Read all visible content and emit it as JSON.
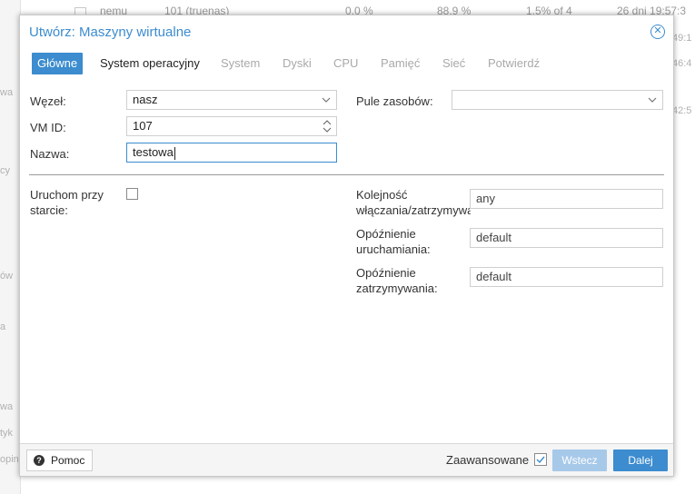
{
  "background": {
    "row_cells": [
      "nemu",
      "101 (truenas)",
      "0.0 %",
      "88.9 %",
      "1.5% of 4",
      "26 dni 19:57:3"
    ],
    "right_fragments": [
      "49:1",
      "46:4",
      "42:5"
    ],
    "left_fragments": [
      "wa",
      "cy",
      "ów",
      "a",
      "wa",
      "tyk",
      "opin"
    ]
  },
  "dialog": {
    "title": "Utwórz: Maszyny wirtualne",
    "close_icon": "close-circle-icon",
    "tabs": [
      {
        "label": "Główne",
        "state": "active"
      },
      {
        "label": "System operacyjny",
        "state": "normal"
      },
      {
        "label": "System",
        "state": "disabled"
      },
      {
        "label": "Dyski",
        "state": "disabled"
      },
      {
        "label": "CPU",
        "state": "disabled"
      },
      {
        "label": "Pamięć",
        "state": "disabled"
      },
      {
        "label": "Sieć",
        "state": "disabled"
      },
      {
        "label": "Potwierdź",
        "state": "disabled"
      }
    ],
    "form": {
      "node_label": "Węzeł:",
      "node_value": "nasz",
      "vmid_label": "VM ID:",
      "vmid_value": "107",
      "name_label": "Nazwa:",
      "name_value": "testowa",
      "pool_label": "Pule zasobów:",
      "pool_value": "",
      "onboot_label_1": "Uruchom przy",
      "onboot_label_2": "starcie:",
      "order_label_1": "Kolejność",
      "order_label_2": "włączania/zatrzymywa",
      "order_value": "any",
      "startup_delay_label_1": "Opóźnienie",
      "startup_delay_label_2": "uruchamiania:",
      "startup_delay_value": "default",
      "shutdown_label_1": "Opóźnienie",
      "shutdown_label_2": "zatrzymywania:",
      "shutdown_value": "default"
    },
    "footer": {
      "help_label": "Pomoc",
      "advanced_label": "Zaawansowane",
      "advanced_checked": true,
      "back_label": "Wstecz",
      "next_label": "Dalej"
    }
  },
  "colors": {
    "accent": "#3c8ccf",
    "disabled_button": "#a7c9e9",
    "disabled_tab_text": "#a9a9a9"
  }
}
